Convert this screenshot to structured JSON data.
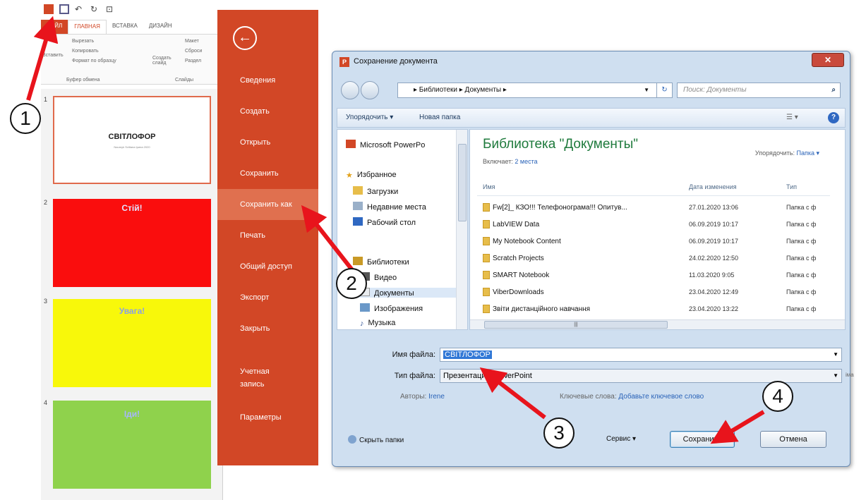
{
  "ppt": {
    "tabs": {
      "file": "ФАЙЛ",
      "home": "ГЛАВНАЯ",
      "insert": "ВСТАВКА",
      "design": "ДИЗАЙН"
    },
    "ribbon": {
      "cut": "Вырезать",
      "copy": "Копировать",
      "format_painter": "Формат по образцу",
      "paste": "Вставить",
      "clipboard_group": "Буфер обмена",
      "new_slide": "Создать слайд",
      "layout": "Макет",
      "reset": "Сброси",
      "section": "Раздел",
      "slides_group": "Слайды"
    },
    "slides": [
      {
        "num": "1",
        "title": "СВІТЛОФОР",
        "subtitle": "Naumyk Svitlana Ірина 2020",
        "color": "#ffffff"
      },
      {
        "num": "2",
        "title": "Стій!",
        "color": "#fa0d0d"
      },
      {
        "num": "3",
        "title": "Увага!",
        "color": "#f8f80a"
      },
      {
        "num": "4",
        "title": "Іди!",
        "color": "#8fd24c"
      }
    ]
  },
  "backstage": {
    "accent": "#d24726",
    "items": [
      "Сведения",
      "Создать",
      "Открыть",
      "Сохранить",
      "Сохранить как",
      "Печать",
      "Общий доступ",
      "Экспорт",
      "Закрыть",
      "Учетная запись",
      "Параметры"
    ],
    "active": "Сохранить как"
  },
  "dialog": {
    "title": "Сохранение документа",
    "address": "▸ Библиотеки ▸ Документы ▸",
    "search_placeholder": "Поиск: Документы",
    "organize": "Упорядочить ▾",
    "new_folder": "Новая папка",
    "nav": {
      "ppt": "Microsoft PowerPo",
      "favorites": "Избранное",
      "downloads": "Загрузки",
      "recent": "Недавние места",
      "desktop": "Рабочий стол",
      "libraries": "Библиотеки",
      "video": "Видео",
      "documents": "Документы",
      "images": "Изображения",
      "music": "Музыка"
    },
    "library_title": "Библиотека \"Документы\"",
    "includes_label": "Включает:",
    "includes_link": "2 места",
    "arrange_label": "Упорядочить:",
    "arrange_value": "Папка ▾",
    "columns": {
      "name": "Имя",
      "date": "Дата изменения",
      "type": "Тип"
    },
    "files": [
      {
        "name": "Fw[2]_ КЗО!!! Телефонограма!!! Опитув...",
        "date": "27.01.2020 13:06",
        "type": "Папка с ф"
      },
      {
        "name": "LabVIEW Data",
        "date": "06.09.2019 10:17",
        "type": "Папка с ф"
      },
      {
        "name": "My Notebook Content",
        "date": "06.09.2019 10:17",
        "type": "Папка с ф"
      },
      {
        "name": "Scratch Projects",
        "date": "24.02.2020 12:50",
        "type": "Папка с ф"
      },
      {
        "name": "SMART Notebook",
        "date": "11.03.2020 9:05",
        "type": "Папка с ф"
      },
      {
        "name": "ViberDownloads",
        "date": "23.04.2020 12:49",
        "type": "Папка с ф"
      },
      {
        "name": "Звіти дистанційного навчання",
        "date": "23.04.2020 13:22",
        "type": "Папка с ф"
      }
    ],
    "filename_label": "Имя файла:",
    "filename_value": "СВІТЛОФОР",
    "filetype_label": "Тип файла:",
    "filetype_value": "Презентация PowerPoint",
    "authors_label": "Авторы:",
    "authors_value": "Irene",
    "keywords_label": "Ключевые слова:",
    "keywords_value": "Добавьте ключевое слово",
    "hide_folders": "Скрыть папки",
    "service": "Сервис",
    "save": "Сохранить",
    "cancel": "Отмена"
  },
  "steps": [
    "1",
    "2",
    "3",
    "4"
  ],
  "arrow_color": "#e8141c",
  "trailing_text": "іма"
}
